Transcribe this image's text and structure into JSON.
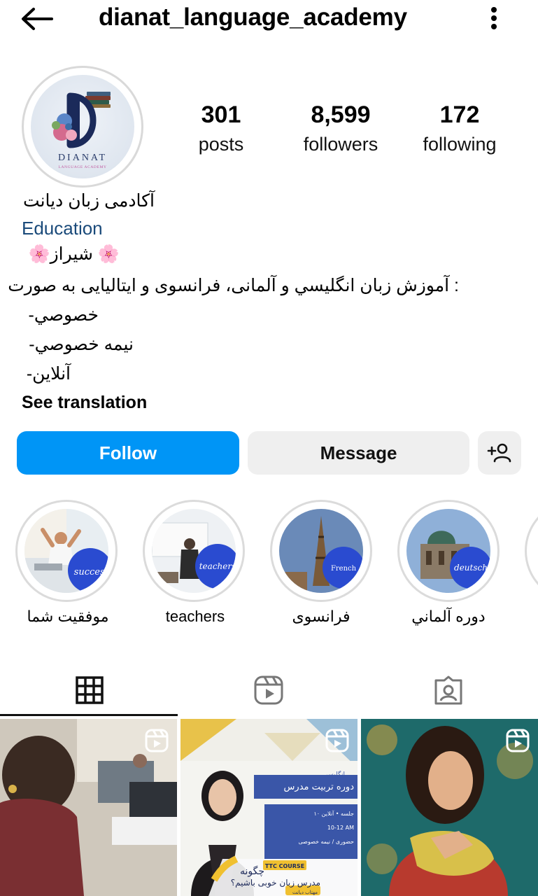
{
  "header": {
    "username": "dianat_language_academy",
    "back_icon": "arrow-left-icon",
    "more_icon": "vertical-dots-icon"
  },
  "profile": {
    "avatar_text": "DIANAT",
    "avatar_subtext": "LANGUAGE ACADEMY",
    "stats": {
      "posts_value": "301",
      "posts_label": "posts",
      "followers_value": "8,599",
      "followers_label": "followers",
      "following_value": "172",
      "following_label": "following"
    }
  },
  "bio": {
    "name": "آکادمی زبان دیانت",
    "category": "Education",
    "city": "🌸 شیراز🌸",
    "description": ": آموزش زبان انگلیسي و آلمانی، فرانسوی و ایتالیایی به صورت",
    "line1": "خصوصي-",
    "line2": "نیمه خصوصي-",
    "line3": "آنلاین-",
    "see_translation": "See translation"
  },
  "actions": {
    "follow": "Follow",
    "message": "Message",
    "add_user_icon": "add-user-icon"
  },
  "highlights": [
    {
      "label": "موفقیت شما",
      "badge": "success"
    },
    {
      "label": "teachers",
      "badge": "teachers"
    },
    {
      "label": "فرانسوی",
      "badge": "French"
    },
    {
      "label": "دوره آلماني",
      "badge": "deutsch"
    }
  ],
  "tabs": [
    {
      "icon": "grid-icon",
      "active": true
    },
    {
      "icon": "reels-icon",
      "active": false
    },
    {
      "icon": "tagged-icon",
      "active": false
    }
  ],
  "posts": [
    {
      "type": "reel",
      "icon": "reel-icon"
    },
    {
      "type": "reel",
      "icon": "reel-icon",
      "course_tag": "TTC COURSE",
      "banner": "دوره تربیت مدرس",
      "banner_sub": "انگلیسی",
      "detail1": "۱۰ جلسه • آنلاین",
      "detail2": "10-12 AM",
      "detail3": "حضوری / نیمه خصوصی",
      "headline1": "چگونه",
      "headline2": "مدرس زبان خوبی باشیم؟",
      "footer": "مهتاب دیانت"
    },
    {
      "type": "reel",
      "icon": "reel-icon"
    }
  ],
  "colors": {
    "follow_blue": "#0095f6",
    "button_gray": "#efefef",
    "category_blue": "#1a4a7a",
    "highlight_badge_blue": "#2a4bd0"
  }
}
